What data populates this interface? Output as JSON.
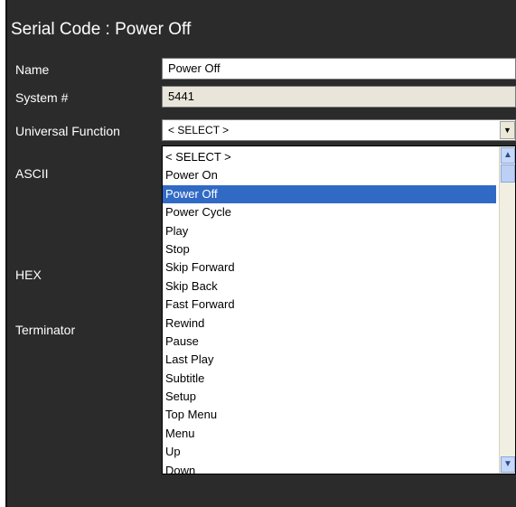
{
  "title": "Serial Code : Power Off",
  "labels": {
    "name": "Name",
    "system": "System #",
    "universal": "Universal Function",
    "ascii": "ASCII",
    "hex": "HEX",
    "terminator": "Terminator"
  },
  "fields": {
    "name_value": "Power Off",
    "system_value": "5441"
  },
  "universal_function": {
    "selected": "< SELECT >",
    "highlighted": "Power Off",
    "options": [
      "< SELECT >",
      "Power On",
      "Power Off",
      "Power Cycle",
      "Play",
      "Stop",
      "Skip Forward",
      "Skip Back",
      "Fast Forward",
      "Rewind",
      "Pause",
      "Last Play",
      "Subtitle",
      "Setup",
      "Top Menu",
      "Menu",
      "Up",
      "Down"
    ]
  },
  "icons": {
    "dropdown": "chevron-down-icon",
    "scroll_up": "chevron-up-icon",
    "scroll_down": "chevron-down-icon"
  },
  "colors": {
    "panel_bg": "#2b2b2b",
    "highlight": "#316ac5",
    "readonly_bg": "#e9e5da"
  }
}
